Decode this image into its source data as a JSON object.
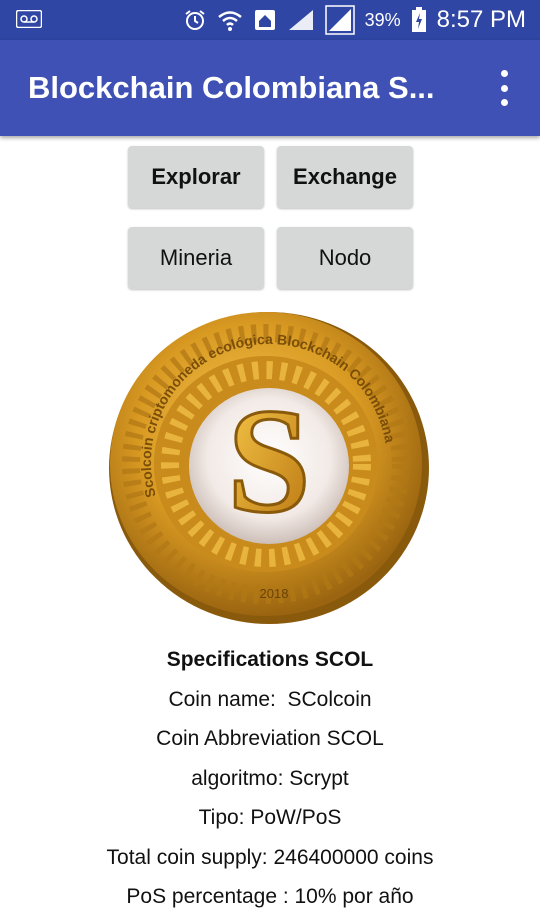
{
  "status_bar": {
    "battery": "39%",
    "time": "8:57 PM"
  },
  "app_bar": {
    "title": "Blockchain Colombiana S..."
  },
  "buttons": {
    "explorar": "Explorar",
    "exchange": "Exchange",
    "mineria": "Mineria",
    "nodo": "Nodo"
  },
  "coin": {
    "ring_text": "Scolcoin criptomoneda ecológica Blockchain Colombiana",
    "year": "2018",
    "letter": "S"
  },
  "specs": {
    "heading": "Specifications SCOL",
    "coin_name": "Coin name:  SColcoin",
    "abbreviation": "Coin Abbreviation SCOL",
    "algorithm": "algoritmo: Scrypt",
    "type": "Tipo: PoW/PoS",
    "supply": "Total coin supply: 246400000 coins",
    "pos": "PoS percentage : 10% por año"
  }
}
